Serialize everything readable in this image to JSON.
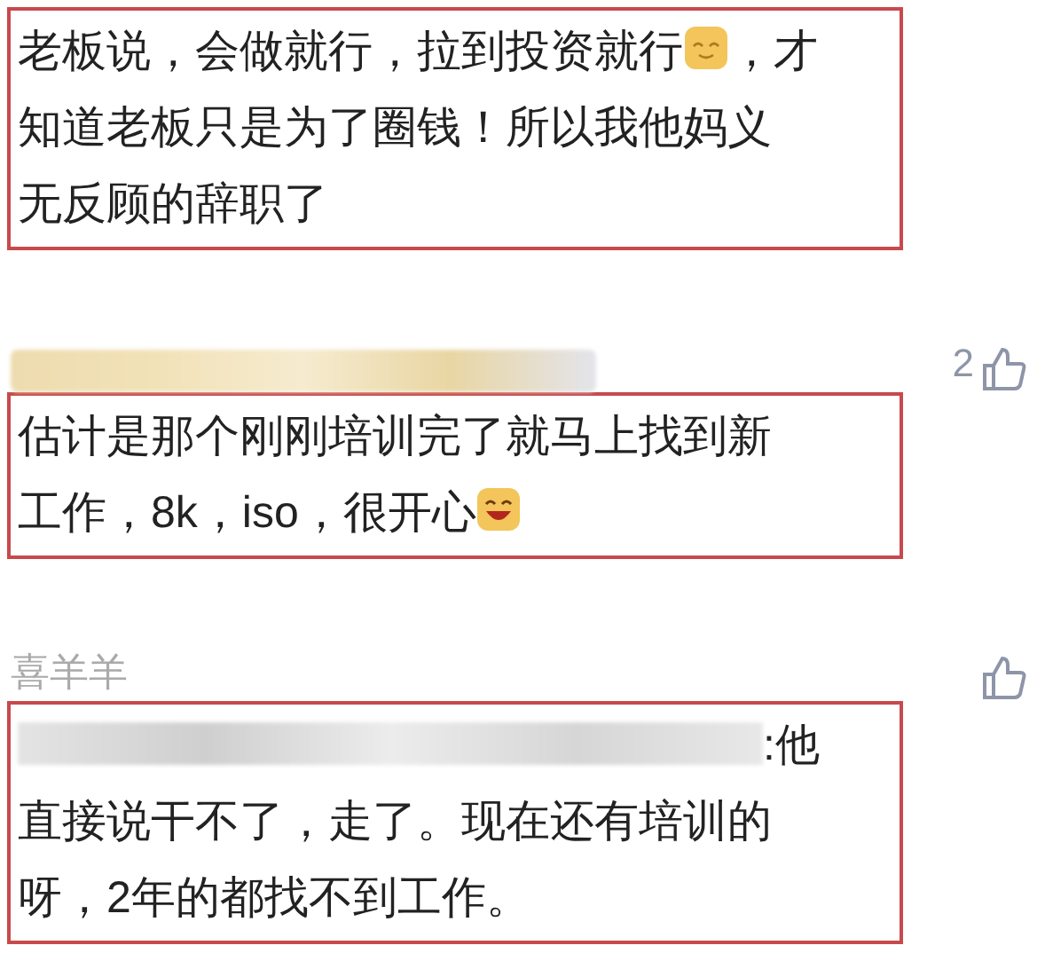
{
  "comments": [
    {
      "lines": [
        [
          {
            "kind": "text",
            "text": "老板说，会做就行，拉到投资就行"
          },
          {
            "kind": "smiley"
          },
          {
            "kind": "text",
            "text": "，才"
          }
        ],
        [
          {
            "kind": "text",
            "text": "知道老板只是为了圈钱！所以我他妈义"
          }
        ],
        [
          {
            "kind": "text",
            "text": "无反顾的辞职了"
          }
        ]
      ]
    },
    {
      "author": {
        "kind": "redacted"
      },
      "likes": "2",
      "lines": [
        [
          {
            "kind": "text",
            "text": "估计是那个刚刚培训完了就马上找到新"
          }
        ],
        [
          {
            "kind": "text",
            "text": "工作，8k，iso，很开心"
          },
          {
            "kind": "grin"
          }
        ]
      ]
    },
    {
      "author": {
        "kind": "text",
        "text": "喜羊羊"
      },
      "lines": [
        [
          {
            "kind": "redacted"
          },
          {
            "kind": "text",
            "text": ":他"
          }
        ],
        [
          {
            "kind": "text",
            "text": "直接说干不了，走了。现在还有培训的"
          }
        ],
        [
          {
            "kind": "text",
            "text": "呀，2年的都找不到工作。"
          }
        ]
      ]
    }
  ]
}
